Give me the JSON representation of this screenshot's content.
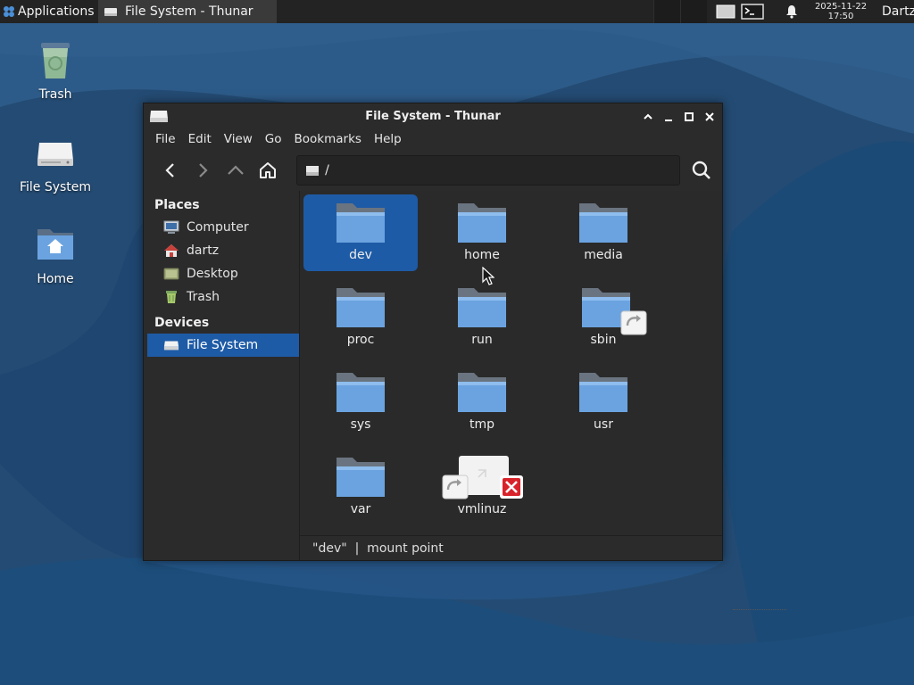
{
  "panel": {
    "applications_label": "Applications ≡",
    "task_title": "File System - Thunar",
    "clock_date": "2025-11-22",
    "clock_time": "17:50",
    "user": "Dartz"
  },
  "desktop": {
    "icons": [
      {
        "label": "Trash",
        "icon": "trash-icon"
      },
      {
        "label": "File System",
        "icon": "drive-icon"
      },
      {
        "label": "Home",
        "icon": "home-folder-icon"
      }
    ]
  },
  "window": {
    "title": "File System - Thunar",
    "menu": [
      "File",
      "Edit",
      "View",
      "Go",
      "Bookmarks",
      "Help"
    ],
    "path": "/",
    "sidebar": {
      "places_heading": "Places",
      "places": [
        {
          "label": "Computer",
          "icon": "computer-icon"
        },
        {
          "label": "dartz",
          "icon": "home-icon"
        },
        {
          "label": "Desktop",
          "icon": "desktop-icon"
        },
        {
          "label": "Trash",
          "icon": "trash-icon"
        }
      ],
      "devices_heading": "Devices",
      "devices": [
        {
          "label": "File System",
          "icon": "drive-icon",
          "selected": true
        }
      ]
    },
    "files": [
      {
        "name": "dev",
        "type": "folder",
        "selected": true
      },
      {
        "name": "home",
        "type": "folder"
      },
      {
        "name": "media",
        "type": "folder"
      },
      {
        "name": "proc",
        "type": "folder"
      },
      {
        "name": "run",
        "type": "folder"
      },
      {
        "name": "sbin",
        "type": "folder-link"
      },
      {
        "name": "sys",
        "type": "folder"
      },
      {
        "name": "tmp",
        "type": "folder"
      },
      {
        "name": "usr",
        "type": "folder"
      },
      {
        "name": "var",
        "type": "folder"
      },
      {
        "name": "vmlinuz",
        "type": "broken-link"
      }
    ],
    "status": "\"dev\"  |  mount point"
  },
  "colors": {
    "selection": "#1e5ba6",
    "window_bg": "#2b2b2b",
    "panel_bg": "#232323",
    "folder_blue": "#6ba3e0"
  }
}
